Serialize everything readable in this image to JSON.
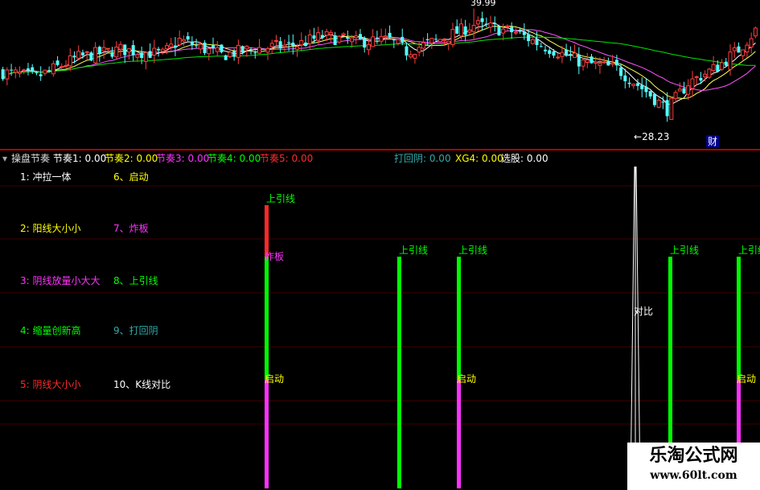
{
  "colors": {
    "up": "#ff3d3d",
    "down": "#54ffff",
    "ma5": "#ffffff",
    "ma10": "#ffff54",
    "ma20": "#ff54ff",
    "ma60": "#00e600",
    "red": "#ff2b2b",
    "yellow": "#ffff00",
    "magenta": "#ff33ff",
    "green": "#00ff00",
    "cyan": "#00cccc",
    "teal": "#33aaaa",
    "white": "#ffffff",
    "grid": "#400000"
  },
  "header": {
    "indicator_name": "操盘节奏",
    "params": [
      {
        "label": "节奏1:",
        "value": "0.00",
        "color": "#ffffff"
      },
      {
        "label": "节奏2:",
        "value": "0.00",
        "color": "#ffff00"
      },
      {
        "label": "节奏3:",
        "value": "0.00",
        "color": "#ff33ff"
      },
      {
        "label": "节奏4:",
        "value": "0.00",
        "color": "#00ff00"
      },
      {
        "label": "节奏5:",
        "value": "0.00",
        "color": "#ff2b2b"
      },
      {
        "label": "打回阴:",
        "value": "0.00",
        "color": "#33aaaa"
      },
      {
        "label": "XG4:",
        "value": "0.00",
        "color": "#ffff00"
      },
      {
        "label": "选股:",
        "value": "0.00",
        "color": "#ffffff"
      }
    ]
  },
  "legend": {
    "left": [
      {
        "text": "1: 冲拉一体",
        "color": "#ffffff"
      },
      {
        "text": "2: 阳线大小小",
        "color": "#ffff00"
      },
      {
        "text": "3: 阴线放量小大大",
        "color": "#ff33ff"
      },
      {
        "text": "4: 缩量创新高",
        "color": "#00ff00"
      },
      {
        "text": "5: 阴线大小小",
        "color": "#ff2b2b"
      }
    ],
    "right": [
      {
        "text": "6、启动",
        "color": "#ffff00"
      },
      {
        "text": "7、炸板",
        "color": "#ff33ff"
      },
      {
        "text": "8、上引线",
        "color": "#00ff00"
      },
      {
        "text": "9、打回阴",
        "color": "#33aaaa"
      },
      {
        "text": "10、K线对比",
        "color": "#ffffff"
      }
    ]
  },
  "chart_data": [
    {
      "type": "candlestick",
      "annotations": {
        "high": "39.99",
        "low": "28.23",
        "low_arrow": "←",
        "badge": "财"
      },
      "bar_count": 180,
      "close_path": [
        [
          0,
          33.4
        ],
        [
          8,
          32.9
        ],
        [
          18,
          35.0
        ],
        [
          28,
          35.8
        ],
        [
          38,
          35.3
        ],
        [
          42,
          36.8
        ],
        [
          52,
          35.2
        ],
        [
          60,
          35.9
        ],
        [
          70,
          36.3
        ],
        [
          76,
          37.2
        ],
        [
          84,
          36.6
        ],
        [
          92,
          36.8
        ],
        [
          96,
          35.6
        ],
        [
          106,
          37.2
        ],
        [
          112,
          38.4
        ],
        [
          122,
          37.6
        ],
        [
          128,
          36.3
        ],
        [
          138,
          34.4
        ],
        [
          146,
          33.8
        ],
        [
          153,
          31.4
        ],
        [
          158,
          29.5
        ],
        [
          163,
          32.3
        ],
        [
          170,
          34.0
        ],
        [
          175,
          35.8
        ],
        [
          179,
          37.8
        ]
      ],
      "ma_lengths": [
        5,
        10,
        20,
        60
      ]
    },
    {
      "type": "signal_bars",
      "signals": [
        {
          "label": "上引线",
          "color": "#00ff00",
          "segments": [
            {
              "color": "#ff2b2b",
              "from": 0.72,
              "to": 0.88
            },
            {
              "color": "#00ff00",
              "from": 0.34,
              "to": 0.72
            },
            {
              "color": "#ff33ff",
              "from": 0,
              "to": 0.34
            }
          ],
          "tags": [
            {
              "text": "炸板",
              "color": "#ff33ff",
              "at": 0.72
            },
            {
              "text": "启动",
              "color": "#ffff00",
              "at": 0.34
            }
          ]
        },
        {
          "label": "上引线",
          "color": "#00ff00",
          "segments": [
            {
              "color": "#00ff00",
              "from": 0,
              "to": 0.72
            }
          ],
          "tags": []
        },
        {
          "label": "上引线",
          "color": "#00ff00",
          "segments": [
            {
              "color": "#00ff00",
              "from": 0.34,
              "to": 0.72
            },
            {
              "color": "#ff33ff",
              "from": 0,
              "to": 0.34
            }
          ],
          "tags": [
            {
              "text": "启动",
              "color": "#ffff00",
              "at": 0.34
            }
          ]
        },
        {
          "label": "",
          "color": "#ffffff",
          "outline": true,
          "from": 0,
          "to": 1.0,
          "tags": [
            {
              "text": "对比",
              "color": "#ffffff",
              "at": 0.55
            }
          ]
        },
        {
          "label": "上引线",
          "color": "#00ff00",
          "segments": [
            {
              "color": "#00ff00",
              "from": 0,
              "to": 0.72
            }
          ],
          "tags": []
        },
        {
          "label": "上引线",
          "color": "#00ff00",
          "segments": [
            {
              "color": "#00ff00",
              "from": 0.34,
              "to": 0.72
            },
            {
              "color": "#ff33ff",
              "from": 0,
              "to": 0.34
            }
          ],
          "tags": [
            {
              "text": "启动",
              "color": "#ffff00",
              "at": 0.34
            }
          ]
        }
      ]
    }
  ],
  "watermark": {
    "title": "乐淘公式网",
    "url": "www.60lt.com"
  }
}
